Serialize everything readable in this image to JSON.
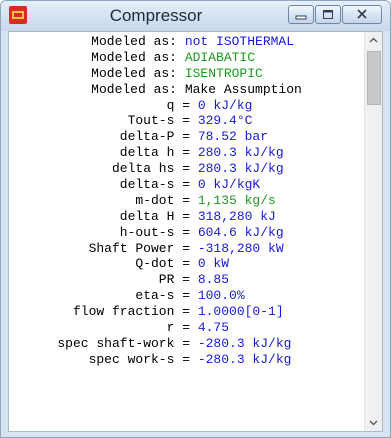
{
  "window": {
    "title": "Compressor"
  },
  "colors": {
    "value_blue": "#1a1ad6",
    "value_green": "#1f9a1f",
    "titlebar": "#d3e1f1"
  },
  "lines": [
    {
      "label": "Modeled as:",
      "value": "not ISOTHERMAL",
      "color": "blue"
    },
    {
      "label": "Modeled as:",
      "value": "ADIABATIC",
      "color": "green"
    },
    {
      "label": "Modeled as:",
      "value": "ISENTROPIC",
      "color": "green"
    },
    {
      "label": "Modeled as:",
      "value": "Make Assumption",
      "color": "black"
    },
    {
      "label": "q =",
      "value": "0 kJ/kg",
      "color": "blue"
    },
    {
      "label": "Tout-s =",
      "value": "329.4°C",
      "color": "blue"
    },
    {
      "label": "delta-P =",
      "value": "78.52 bar",
      "color": "blue"
    },
    {
      "label": "delta h =",
      "value": "280.3 kJ/kg",
      "color": "blue"
    },
    {
      "label": "delta hs =",
      "value": "280.3 kJ/kg",
      "color": "blue"
    },
    {
      "label": "delta-s =",
      "value": "0 kJ/kgK",
      "color": "blue"
    },
    {
      "label": "m-dot =",
      "value": "1,135 kg/s",
      "color": "green"
    },
    {
      "label": "delta H =",
      "value": "318,280 kJ",
      "color": "blue"
    },
    {
      "label": "h-out-s =",
      "value": "604.6 kJ/kg",
      "color": "blue"
    },
    {
      "label": "Shaft Power =",
      "value": "-318,280 kW",
      "color": "blue"
    },
    {
      "label": "Q-dot =",
      "value": "0 kW",
      "color": "blue"
    },
    {
      "label": "PR =",
      "value": "8.85",
      "color": "blue"
    },
    {
      "label": "eta-s =",
      "value": "100.0%",
      "color": "blue"
    },
    {
      "label": "flow fraction =",
      "value": "1.0000[0-1]",
      "color": "blue"
    },
    {
      "label": "r =",
      "value": "4.75",
      "color": "blue"
    },
    {
      "label": "spec shaft-work =",
      "value": "-280.3 kJ/kg",
      "color": "blue"
    },
    {
      "label": "spec work-s =",
      "value": "-280.3 kJ/kg",
      "color": "blue"
    }
  ]
}
